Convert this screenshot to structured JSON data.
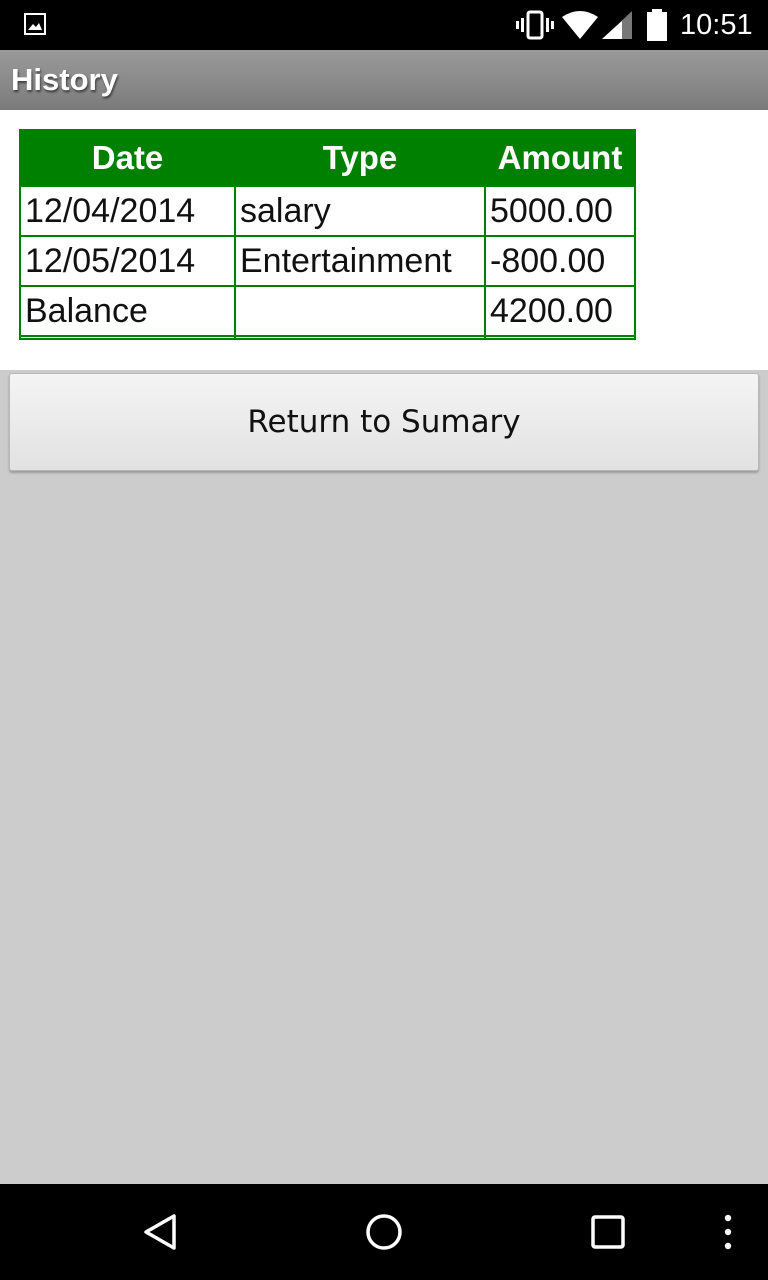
{
  "status_bar": {
    "time": "10:51",
    "icons": [
      "image-notification-icon",
      "vibrate-icon",
      "wifi-icon",
      "cell-signal-icon",
      "battery-icon"
    ]
  },
  "app": {
    "title": "History"
  },
  "table": {
    "headers": [
      "Date",
      "Type",
      "Amount"
    ],
    "rows": [
      [
        "12/04/2014",
        "salary",
        "5000.00"
      ],
      [
        "12/05/2014",
        "Entertainment",
        "-800.00"
      ],
      [
        "Balance",
        "",
        "4200.00"
      ]
    ]
  },
  "buttons": {
    "return_label": "Return to Sumary"
  },
  "nav_bar": {
    "icons": [
      "back-icon",
      "home-icon",
      "recents-icon",
      "overflow-menu-icon"
    ]
  },
  "colors": {
    "table_header_bg": "#008000",
    "table_border": "#008000",
    "status_bar_bg": "#000000",
    "screen_bg": "#cccccc"
  }
}
